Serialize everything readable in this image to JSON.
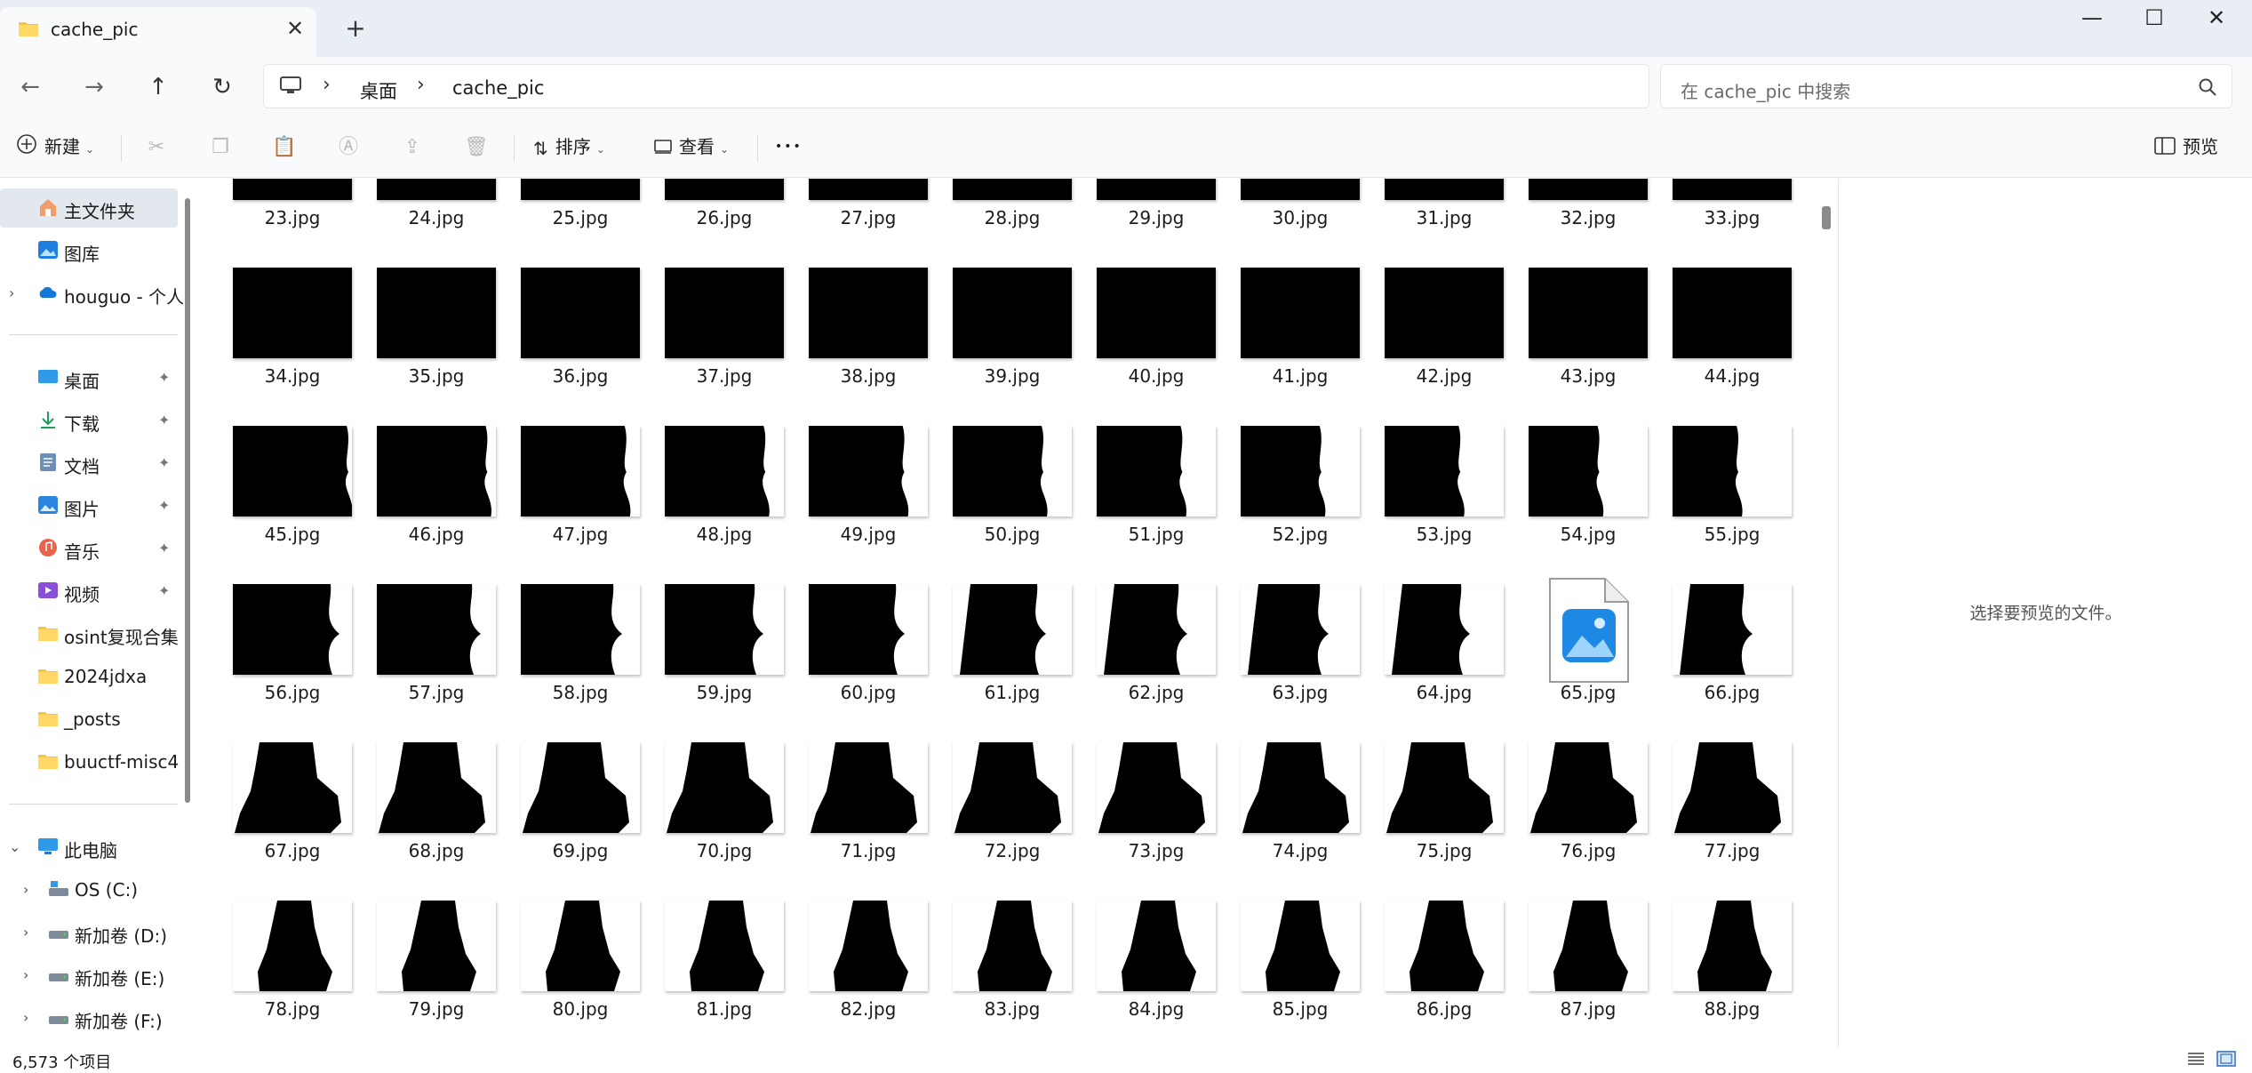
{
  "window": {
    "tab_title": "cache_pic",
    "new_tab": "+",
    "close_tab": "✕",
    "minimize": "—",
    "maximize": "☐",
    "close": "✕"
  },
  "nav": {
    "back": "←",
    "forward": "→",
    "up": "↑",
    "refresh": "↻"
  },
  "address": {
    "sep": "›",
    "crumbs": [
      "桌面",
      "cache_pic"
    ]
  },
  "search": {
    "placeholder": "在 cache_pic 中搜索"
  },
  "toolbar": {
    "new_label": "新建",
    "sort_label": "排序",
    "view_label": "查看",
    "more_label": "•••",
    "preview_label": "预览",
    "chevron": "⌄",
    "disabled_icons": [
      "cut-icon",
      "copy-icon",
      "paste-icon",
      "rename-icon",
      "share-icon",
      "delete-icon"
    ]
  },
  "sidebar": {
    "pinned": [
      {
        "label": "主文件夹",
        "icon": "home-icon"
      },
      {
        "label": "图库",
        "icon": "gallery-icon"
      },
      {
        "label": "houguo - 个人",
        "icon": "cloud-icon"
      }
    ],
    "quick": [
      {
        "label": "桌面",
        "icon": "desktop-icon"
      },
      {
        "label": "下载",
        "icon": "download-icon"
      },
      {
        "label": "文档",
        "icon": "documents-icon"
      },
      {
        "label": "图片",
        "icon": "pictures-icon"
      },
      {
        "label": "音乐",
        "icon": "music-icon"
      },
      {
        "label": "视频",
        "icon": "videos-icon"
      },
      {
        "label": "osint复现合集",
        "icon": "folder-icon"
      },
      {
        "label": "2024jdxa",
        "icon": "folder-icon"
      },
      {
        "label": "_posts",
        "icon": "folder-icon"
      },
      {
        "label": "buuctf-misc4",
        "icon": "folder-icon"
      }
    ],
    "this_pc": {
      "label": "此电脑",
      "icon": "computer-icon"
    },
    "drives": [
      {
        "label": "OS (C:)",
        "icon": "drive-icon"
      },
      {
        "label": "新加卷 (D:)",
        "icon": "drive-icon"
      },
      {
        "label": "新加卷 (E:)",
        "icon": "drive-icon"
      },
      {
        "label": "新加卷 (F:)",
        "icon": "drive-icon"
      }
    ],
    "chevron_right": "›",
    "chevron_down": "⌄",
    "pin_glyph": "📌"
  },
  "files": [
    "23.jpg",
    "24.jpg",
    "25.jpg",
    "26.jpg",
    "27.jpg",
    "28.jpg",
    "29.jpg",
    "30.jpg",
    "31.jpg",
    "32.jpg",
    "33.jpg",
    "34.jpg",
    "35.jpg",
    "36.jpg",
    "37.jpg",
    "38.jpg",
    "39.jpg",
    "40.jpg",
    "41.jpg",
    "42.jpg",
    "43.jpg",
    "44.jpg",
    "45.jpg",
    "46.jpg",
    "47.jpg",
    "48.jpg",
    "49.jpg",
    "50.jpg",
    "51.jpg",
    "52.jpg",
    "53.jpg",
    "54.jpg",
    "55.jpg",
    "56.jpg",
    "57.jpg",
    "58.jpg",
    "59.jpg",
    "60.jpg",
    "61.jpg",
    "62.jpg",
    "63.jpg",
    "64.jpg",
    "65.jpg",
    "66.jpg",
    "67.jpg",
    "68.jpg",
    "69.jpg",
    "70.jpg",
    "71.jpg",
    "72.jpg",
    "73.jpg",
    "74.jpg",
    "75.jpg",
    "76.jpg",
    "77.jpg",
    "78.jpg",
    "79.jpg",
    "80.jpg",
    "81.jpg",
    "82.jpg",
    "83.jpg",
    "84.jpg",
    "85.jpg",
    "86.jpg",
    "87.jpg",
    "88.jpg"
  ],
  "no_thumbnail_file": "65.jpg",
  "preview": {
    "message": "选择要预览的文件。"
  },
  "status": {
    "item_count": "6,573 个项目"
  }
}
